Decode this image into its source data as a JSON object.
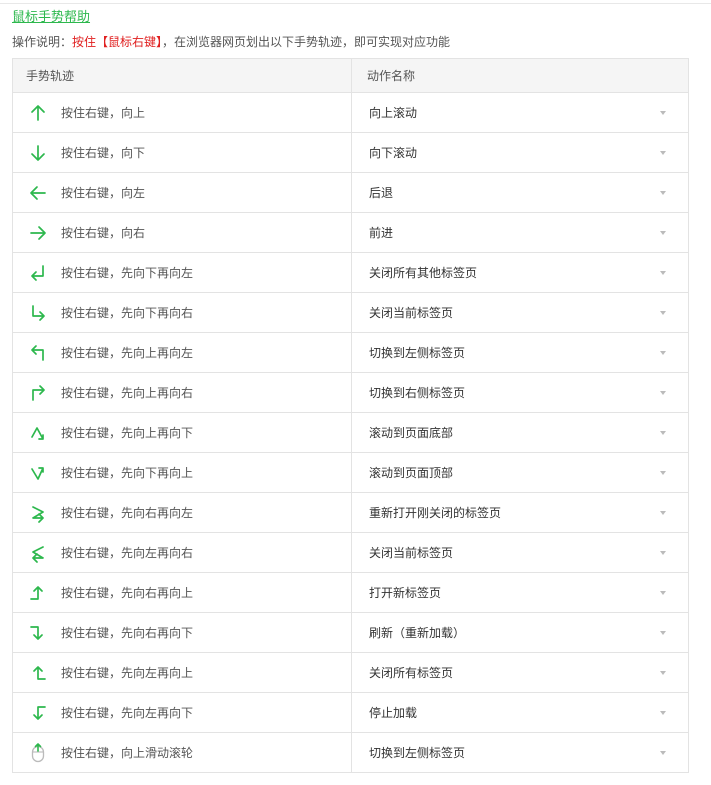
{
  "header": {
    "help_link": "鼠标手势帮助",
    "instructions_prefix": "操作说明：",
    "instructions_highlight": "按住【鼠标右键】",
    "instructions_suffix": "，在浏览器网页划出以下手势轨迹，即可实现对应功能"
  },
  "table": {
    "col_gesture": "手势轨迹",
    "col_action": "动作名称",
    "rows": [
      {
        "icon": "arrow-up-icon",
        "gesture": "按住右键，向上",
        "action": "向上滚动"
      },
      {
        "icon": "arrow-down-icon",
        "gesture": "按住右键，向下",
        "action": "向下滚动"
      },
      {
        "icon": "arrow-left-icon",
        "gesture": "按住右键，向左",
        "action": "后退"
      },
      {
        "icon": "arrow-right-icon",
        "gesture": "按住右键，向右",
        "action": "前进"
      },
      {
        "icon": "down-then-left-icon",
        "gesture": "按住右键，先向下再向左",
        "action": "关闭所有其他标签页"
      },
      {
        "icon": "down-then-right-icon",
        "gesture": "按住右键，先向下再向右",
        "action": "关闭当前标签页"
      },
      {
        "icon": "up-then-left-icon",
        "gesture": "按住右键，先向上再向左",
        "action": "切换到左侧标签页"
      },
      {
        "icon": "up-then-right-icon",
        "gesture": "按住右键，先向上再向右",
        "action": "切换到右侧标签页"
      },
      {
        "icon": "up-then-down-icon",
        "gesture": "按住右键，先向上再向下",
        "action": "滚动到页面底部"
      },
      {
        "icon": "down-then-up-icon",
        "gesture": "按住右键，先向下再向上",
        "action": "滚动到页面顶部"
      },
      {
        "icon": "right-then-left-icon",
        "gesture": "按住右键，先向右再向左",
        "action": "重新打开刚关闭的标签页"
      },
      {
        "icon": "left-then-right-icon",
        "gesture": "按住右键，先向左再向右",
        "action": "关闭当前标签页"
      },
      {
        "icon": "right-then-up-icon",
        "gesture": "按住右键，先向右再向上",
        "action": "打开新标签页"
      },
      {
        "icon": "right-then-down-icon",
        "gesture": "按住右键，先向右再向下",
        "action": "刷新（重新加载）"
      },
      {
        "icon": "left-then-up-icon",
        "gesture": "按住右键，先向左再向上",
        "action": "关闭所有标签页"
      },
      {
        "icon": "left-then-down-icon",
        "gesture": "按住右键，先向左再向下",
        "action": "停止加载"
      },
      {
        "icon": "scroll-wheel-up-icon",
        "gesture": "按住右键，向上滑动滚轮",
        "action": "切换到左侧标签页"
      }
    ]
  },
  "colors": {
    "accent": "#2db84d",
    "highlight": "#e02020",
    "border": "#e3e3e3",
    "header_bg": "#f5f5f5"
  }
}
